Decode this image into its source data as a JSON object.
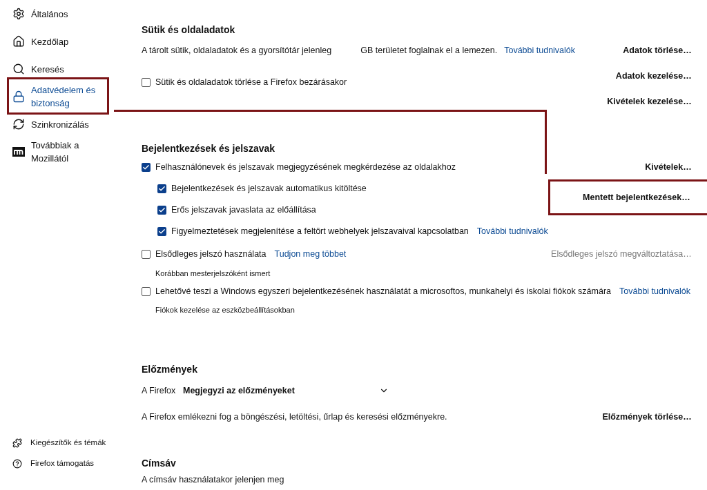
{
  "sidebar": {
    "items": [
      {
        "label": "Általános",
        "selected": false,
        "highlighted": false
      },
      {
        "label": "Kezdőlap",
        "selected": false,
        "highlighted": false
      },
      {
        "label": "Keresés",
        "selected": false,
        "highlighted": false
      },
      {
        "label": "Adatvédelem és biztonság",
        "selected": true,
        "highlighted": true
      },
      {
        "label": "Szinkronizálás",
        "selected": false,
        "highlighted": false
      },
      {
        "label": "Továbbiak a Mozillától",
        "selected": false,
        "highlighted": false
      }
    ],
    "footer_items": [
      {
        "label": "Kiegészítők és témák"
      },
      {
        "label": "Firefox támogatás"
      }
    ]
  },
  "cookies": {
    "heading": "Sütik és oldaladatok",
    "description_before": "A tárolt sütik, oldaladatok és a gyorsítótár jelenleg",
    "description_after": "GB területet foglalnak el a lemezen.",
    "link": "További tudnivalók",
    "checkbox": {
      "label": "Sütik és oldaladatok törlése a Firefox bezárásakor",
      "checked": false
    },
    "buttons": [
      {
        "label": "Adatok törlése…"
      },
      {
        "label": "Adatok kezelése…"
      },
      {
        "label": "Kivételek kezelése…"
      }
    ]
  },
  "logins": {
    "heading": "Bejelentkezések és jelszavak",
    "main": {
      "label": "Felhasználónevek és jelszavak megjegyzésének megkérdezése az oldalakhoz",
      "checked": true
    },
    "exceptions_button": {
      "label": "Kivételek…"
    },
    "sub_options": [
      {
        "label": "Bejelentkezések és jelszavak automatikus kitöltése",
        "checked": true
      },
      {
        "label": "Erős jelszavak javaslata az előállítása",
        "checked": true
      },
      {
        "label": "Figyelmeztetések megjelenítése a feltört webhelyek jelszavaival kapcsolatban",
        "checked": true,
        "link": "További tudnivalók"
      }
    ],
    "saved_button": {
      "label": "Mentett bejelentkezések…",
      "highlighted": true
    },
    "primary_password": {
      "label": "Elsődleges jelszó használata",
      "checked": false,
      "link": "Tudjon meg többet",
      "note": "Korábban mesterjelszóként ismert",
      "button": {
        "label": "Elsődleges jelszó megváltoztatása…",
        "disabled": true
      }
    },
    "windows_sso": {
      "label": "Lehetővé teszi a Windows egyszeri bejelentkezésének használatát a microsoftos, munkahelyi és iskolai fiókok számára",
      "checked": false,
      "link": "További tudnivalók",
      "note": "Fiókok kezelése az eszközbeállításokban"
    }
  },
  "history": {
    "heading": "Előzmények",
    "select_label": "A Firefox",
    "select_value": "Megjegyzi az előzményeket",
    "description": "A Firefox emlékezni fog a böngészési, letöltési, űrlap és keresési előzményekre.",
    "button": {
      "label": "Előzmények törlése…"
    }
  },
  "address_bar": {
    "heading": "Címsáv",
    "description": "A címsáv használatakor jelenjen meg"
  }
}
